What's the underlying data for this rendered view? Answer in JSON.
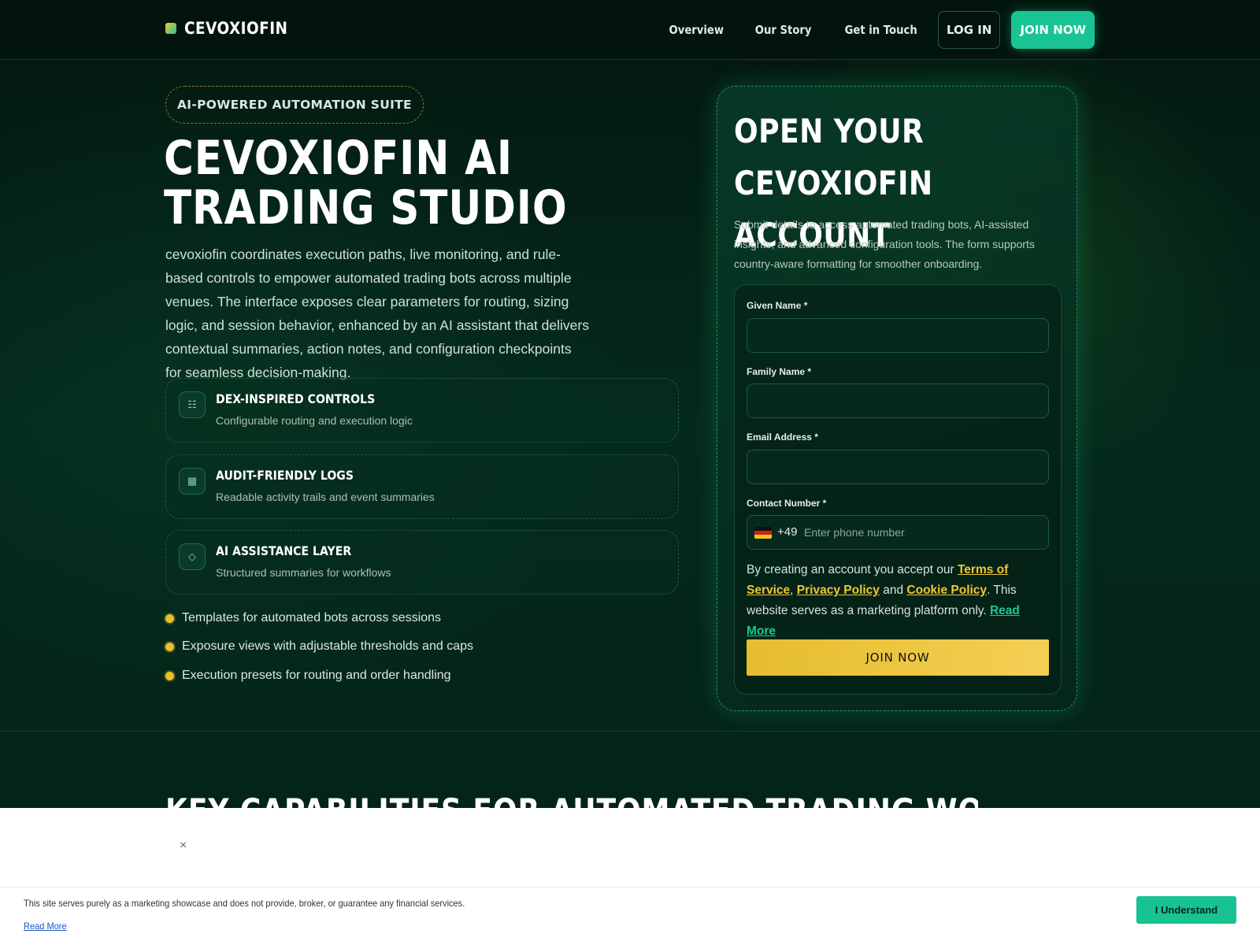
{
  "header": {
    "brand": "CEVOXIOFIN",
    "nav": [
      "Overview",
      "Our Story",
      "Get in Touch"
    ],
    "login_label": "LOG IN",
    "join_label": "JOIN NOW"
  },
  "hero": {
    "pill": "AI-POWERED AUTOMATION SUITE",
    "title": "CEVOXIOFIN AI TRADING STUDIO",
    "description": "cevoxiofin coordinates execution paths, live monitoring, and rule-based controls to empower automated trading bots across multiple venues. The interface exposes clear parameters for routing, sizing logic, and session behavior, enhanced by an AI assistant that delivers contextual summaries, action notes, and configuration checkpoints for seamless decision-making.",
    "features": [
      {
        "icon": "sliders-icon",
        "title": "DEX-INSPIRED CONTROLS",
        "subtitle": "Configurable routing and execution logic"
      },
      {
        "icon": "grid-icon",
        "title": "AUDIT-FRIENDLY LOGS",
        "subtitle": "Readable activity trails and event summaries"
      },
      {
        "icon": "diamond-icon",
        "title": "AI ASSISTANCE LAYER",
        "subtitle": "Structured summaries for workflows"
      }
    ],
    "bullets": [
      "Templates for automated bots across sessions",
      "Exposure views with adjustable thresholds and caps",
      "Execution presets for routing and order handling"
    ]
  },
  "form": {
    "title": "OPEN YOUR CEVOXIOFIN ACCOUNT",
    "description": "Submit details to access automated trading bots, AI-assisted insights, and advanced configuration tools. The form supports country-aware formatting for smoother onboarding.",
    "given_name_label": "Given Name *",
    "family_name_label": "Family Name *",
    "email_label": "Email Address *",
    "phone_label": "Contact Number *",
    "phone_code": "+49",
    "phone_placeholder": "Enter phone number",
    "terms_prefix": "By creating an account you accept our ",
    "terms_link": "Terms of Service",
    "terms_comma": ",",
    "privacy_link": "Privacy Policy",
    "terms_and": " and ",
    "cookie_link": "Cookie Policy",
    "terms_suffix": ". This website serves as a marketing platform only. ",
    "read_more": "Read More",
    "submit_label": "JOIN NOW"
  },
  "section": {
    "title": "KEY CAPABILITIES FOR AUTOMATED TRADING WORKFLOWS"
  },
  "cookie": {
    "close": "×",
    "text": "This site serves purely as a marketing showcase and does not provide, broker, or guarantee any financial services.",
    "read_more": "Read More",
    "accept_label": "I Understand"
  },
  "colors": {
    "accent_green": "#1ac393",
    "accent_yellow": "#e8c22a",
    "background": "#031d14"
  }
}
